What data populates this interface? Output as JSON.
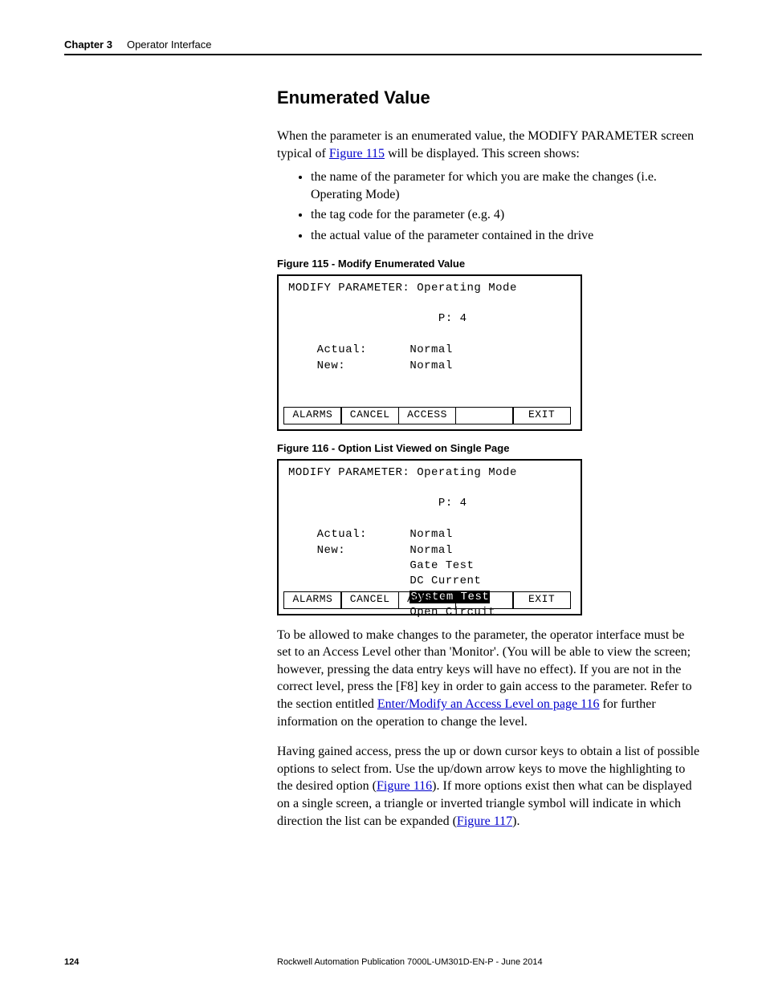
{
  "header": {
    "chapter_num": "Chapter 3",
    "chapter_name": "Operator Interface"
  },
  "section_title": "Enumerated Value",
  "para1_part1": "When the parameter is an enumerated value, the MODIFY PARAMETER screen typical of ",
  "para1_link": "Figure 115",
  "para1_part2": " will be displayed. This screen shows:",
  "bullets": [
    "the name of the parameter for which you are make the changes (i.e. Operating Mode)",
    "the tag code for the parameter (e.g. 4)",
    "the actual value of the parameter contained in the drive"
  ],
  "fig115_caption": "Figure 115 - Modify Enumerated Value",
  "screen1": {
    "title": "MODIFY PARAMETER: Operating Mode",
    "p_line": "                     P: 4",
    "actual": "    Actual:      Normal",
    "new": "    New:         Normal",
    "softkeys": [
      "ALARMS",
      "CANCEL",
      "ACCESS",
      "",
      "EXIT"
    ]
  },
  "fig116_caption": "Figure 116 - Option List Viewed on Single Page",
  "screen2": {
    "title": "MODIFY PARAMETER: Operating Mode",
    "p_line": "                     P: 4",
    "actual": "    Actual:      Normal",
    "new": "    New:         Normal",
    "opt1": "                 Gate Test",
    "opt2": "                 DC Current",
    "opt3_pre": "                 ",
    "opt3_sel": "System Test",
    "opt4": "                 Open Circuit",
    "softkeys": [
      "ALARMS",
      "CANCEL",
      "ACCESS",
      "",
      "EXIT"
    ]
  },
  "para2_part1": "To be allowed to make changes to the parameter, the operator interface must be set to an Access Level other than 'Monitor'.  (You will be able to view the screen; however, pressing the data entry keys will have no effect). If you are not in the correct level, press the [F8] key in order to gain access to the parameter. Refer to the section entitled ",
  "para2_link": "Enter/Modify an Access Level  on page 116",
  "para2_part2": " for further information on the operation to change the level.",
  "para3_part1": "Having gained access, press the up or down cursor keys to obtain a list of possible options to select from. Use the up/down arrow keys to move the highlighting to the desired option (",
  "para3_link1": "Figure 116",
  "para3_mid": "). If more options exist then what can be displayed on a single screen, a triangle or inverted triangle symbol will indicate in which direction the list can be expanded (",
  "para3_link2": "Figure 117",
  "para3_end": ").",
  "footer": {
    "page": "124",
    "pub": "Rockwell Automation Publication 7000L-UM301D-EN-P - June 2014"
  }
}
